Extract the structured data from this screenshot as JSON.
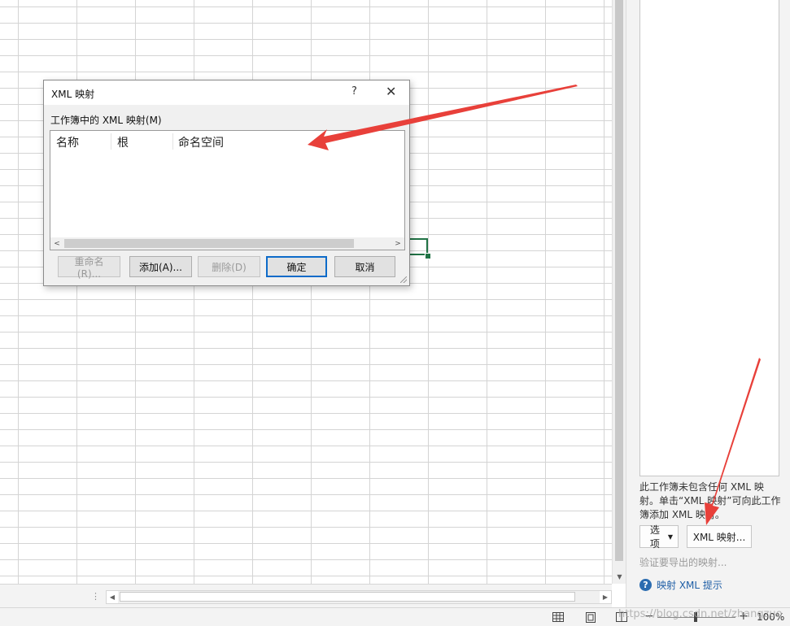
{
  "dialog": {
    "title": "XML 映射",
    "help_glyph": "?",
    "close_glyph": "✕",
    "list_label": "工作簿中的 XML 映射(M)",
    "columns": [
      "名称",
      "根",
      "命名空间"
    ],
    "buttons": {
      "rename": "重命名(R)...",
      "add": "添加(A)...",
      "delete": "删除(D)",
      "ok": "确定",
      "cancel": "取消"
    }
  },
  "task_pane": {
    "info_text": "此工作簿未包含任何 XML 映射。单击“XML 映射”可向此工作簿添加 XML 映射。",
    "options_label": "选项",
    "xml_maps_button": "XML 映射...",
    "verify_label": "验证要导出的映射...",
    "help_link": "映射 XML 提示"
  },
  "status_bar": {
    "zoom_percent": "100%",
    "zoom_minus": "−",
    "zoom_plus": "+"
  },
  "watermark": "https://blog.csdn.net/zhangzuo",
  "colors": {
    "accent": "#217346",
    "link": "#1f5fa6",
    "arrow": "#e8403a",
    "primary_button_border": "#0d6bc9"
  }
}
